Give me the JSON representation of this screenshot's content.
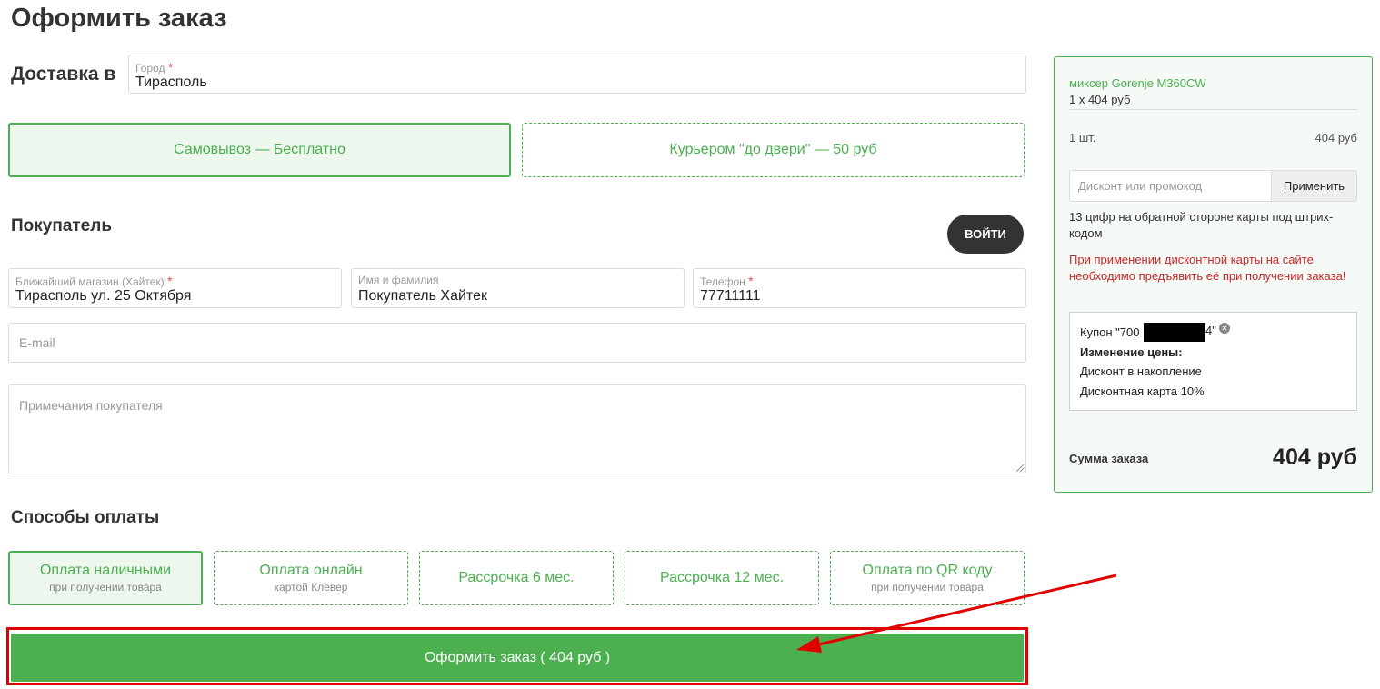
{
  "page": {
    "title": "Оформить заказ"
  },
  "delivery": {
    "label": "Доставка в",
    "city_label": "Город",
    "city_value": "Тирасполь",
    "options": [
      {
        "label": "Самовывоз — Бесплатно",
        "active": true
      },
      {
        "label": "Курьером \"до двери\" — 50 руб",
        "active": false
      }
    ]
  },
  "buyer": {
    "title": "Покупатель",
    "login_label": "ВОЙТИ",
    "store_label": "Ближайший магазин (Хайтек)",
    "store_value": "Тирасполь ул. 25 Октября",
    "name_label": "Имя и фамилия",
    "name_value": "Покупатель Хайтек",
    "phone_label": "Телефон",
    "phone_value": "77711111",
    "email_placeholder": "E-mail",
    "notes_placeholder": "Примечания покупателя"
  },
  "payment": {
    "title": "Способы оплаты",
    "options": [
      {
        "label": "Оплата наличными",
        "sub": "при получении товара",
        "active": true
      },
      {
        "label": "Оплата онлайн",
        "sub": "картой Клевер",
        "active": false
      },
      {
        "label": "Рассрочка 6 мес.",
        "sub": "",
        "active": false
      },
      {
        "label": "Рассрочка 12 мес.",
        "sub": "",
        "active": false
      },
      {
        "label": "Оплата по QR коду",
        "sub": "при получении товара",
        "active": false
      }
    ]
  },
  "submit": {
    "label": "Оформить заказ ( 404 руб )"
  },
  "summary": {
    "product_name": "миксер Gorenje M360CW",
    "product_price": "1 x 404 руб",
    "qty": "1 шт.",
    "qty_total": "404 руб",
    "promo_placeholder": "Дисконт или промокод",
    "promo_button": "Применить",
    "card_hint": "13 цифр на обратной стороне карты под штрих-кодом",
    "card_warning": "При применении дисконтной карты на сайте необходимо предъявить её при получении заказа!",
    "coupon": {
      "prefix": "Купон \"700",
      "suffix": "4\"",
      "price_change_title": "Изменение цены:",
      "line1": "Дисконт в накопление",
      "line2": "Дисконтная карта 10%"
    },
    "total_label": "Сумма заказа",
    "total_value": "404 руб"
  },
  "colors": {
    "accent": "#4caf50",
    "dark": "#333333",
    "warning": "#c62828",
    "highlight": "#e00000"
  }
}
